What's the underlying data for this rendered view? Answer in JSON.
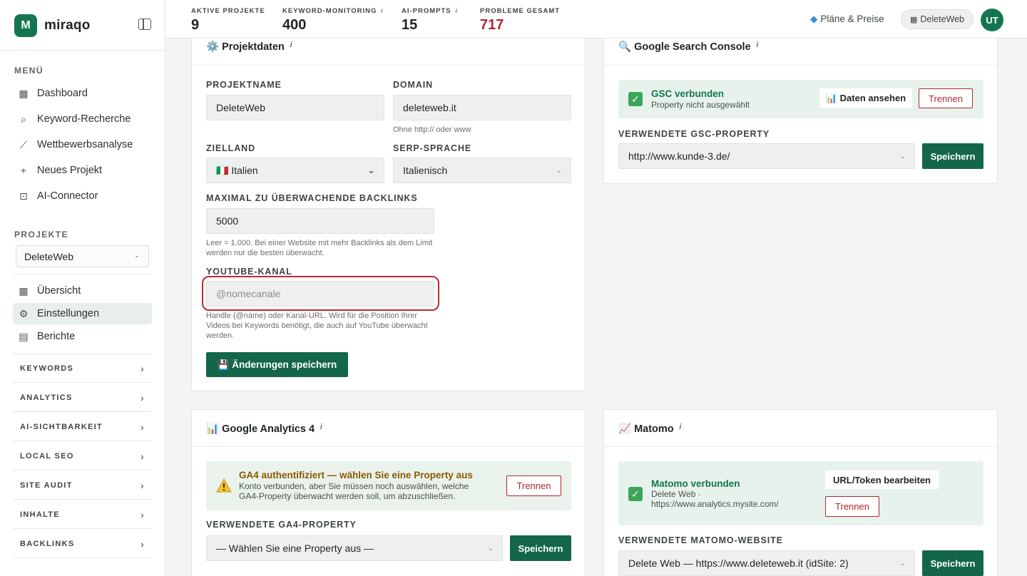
{
  "brand": {
    "logo_letter": "M",
    "name": "miraqo"
  },
  "sidebar": {
    "menu_label": "MENÜ",
    "menu": [
      {
        "label": "Dashboard",
        "icon": "grid-icon"
      },
      {
        "label": "Keyword-Recherche",
        "icon": "search-icon"
      },
      {
        "label": "Wettbewerbsanalyse",
        "icon": "chart-line-icon"
      },
      {
        "label": "Neues Projekt",
        "icon": "plus-icon"
      },
      {
        "label": "AI-Connector",
        "icon": "robot-icon"
      }
    ],
    "projects_label": "PROJEKTE",
    "project_select": "DeleteWeb",
    "project_nav": [
      {
        "label": "Übersicht",
        "icon": "grid-icon"
      },
      {
        "label": "Einstellungen",
        "icon": "gear-icon",
        "active": true
      },
      {
        "label": "Berichte",
        "icon": "document-icon"
      }
    ],
    "groups": [
      "KEYWORDS",
      "ANALYTICS",
      "AI-SICHTBARKEIT",
      "LOCAL SEO",
      "SITE AUDIT",
      "INHALTE",
      "BACKLINKS"
    ]
  },
  "topbar": {
    "stats": [
      {
        "label": "AKTIVE PROJEKTE",
        "value": "9",
        "info": ""
      },
      {
        "label": "KEYWORD-MONITORING",
        "value": "400",
        "info": "i"
      },
      {
        "label": "AI-PROMPTS",
        "value": "15",
        "info": "i"
      },
      {
        "label": "PROBLEME GESAMT",
        "value": "717",
        "info": ""
      }
    ],
    "plans_label": "Pläne & Preise",
    "project_chip": "DeleteWeb",
    "avatar": "UT"
  },
  "projektdaten": {
    "title": "⚙️ Projektdaten",
    "info": "i",
    "projektname_label": "PROJEKTNAME",
    "projektname_value": "DeleteWeb",
    "domain_label": "DOMAIN",
    "domain_value": "deleteweb.it",
    "domain_hint": "Ohne http:// oder www",
    "zielland_label": "ZIELLAND",
    "zielland_value": "🇮🇹 Italien",
    "serp_label": "SERP-SPRACHE",
    "serp_value": "Italienisch",
    "backlinks_label": "MAXIMAL ZU ÜBERWACHENDE BACKLINKS",
    "backlinks_value": "5000",
    "backlinks_hint": "Leer = 1.000. Bei einer Website mit mehr Backlinks als dem Limit werden nur die besten überwacht.",
    "youtube_label": "YOUTUBE-KANAL",
    "youtube_placeholder": "@nomecanale",
    "youtube_hint": "Handle (@name) oder Kanal-URL. Wird für die Position Ihrer Videos bei Keywords benötigt, die auch auf YouTube überwacht werden.",
    "save_label": "💾 Änderungen speichern"
  },
  "gsc": {
    "title": "🔍 Google Search Console",
    "info": "i",
    "status_title": "GSC verbunden",
    "status_sub": "Property nicht ausgewählt",
    "view_label": "📊 Daten ansehen",
    "disconnect_label": "Trennen",
    "property_label": "VERWENDETE GSC-PROPERTY",
    "property_value": "http://www.kunde-3.de/",
    "save_label": "Speichern"
  },
  "ga4": {
    "title": "📊 Google Analytics 4",
    "info": "i",
    "status_title": "GA4 authentifiziert — wählen Sie eine Property aus",
    "status_sub": "Konto verbunden, aber Sie müssen noch auswählen, welche GA4-Property überwacht werden soll, um abzuschließen.",
    "disconnect_label": "Trennen",
    "property_label": "VERWENDETE GA4-PROPERTY",
    "property_value": "— Wählen Sie eine Property aus —",
    "save_label": "Speichern"
  },
  "matomo": {
    "title": "📈 Matomo",
    "info": "i",
    "status_title": "Matomo verbunden",
    "status_sub": "Delete Web · https://www.analytics.mysite.com/",
    "edit_label": "URL/Token bearbeiten",
    "disconnect_label": "Trennen",
    "website_label": "VERWENDETE MATOMO-WEBSITE",
    "website_value": "Delete Web — https://www.deleteweb.it (idSite: 2)",
    "save_label": "Speichern"
  }
}
